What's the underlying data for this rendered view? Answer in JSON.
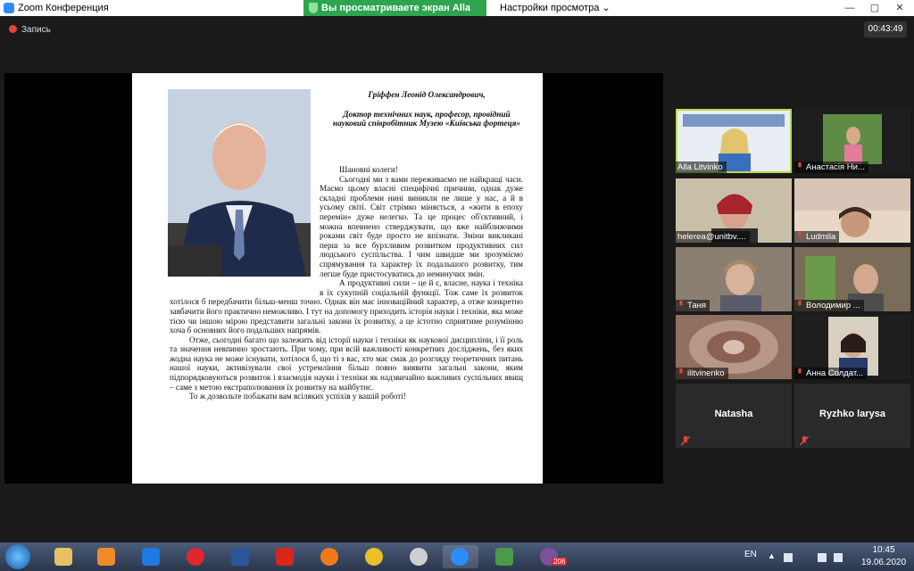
{
  "window": {
    "title": "Zoom Конференция",
    "minimize": "—",
    "maximize": "▢",
    "close": "✕"
  },
  "share_banner": {
    "text": "Вы просматриваете экран Alla Litvinko",
    "view_settings": "Настройки просмотра",
    "color": "#2da44e"
  },
  "toolbar": {
    "record_label": "Запись",
    "timer": "00:43:49"
  },
  "document": {
    "header": [
      "Гріффен Леонід Олександрович,",
      "Доктор технічних наук, професор, провідний науковий співробітник Музею «Київська фортеця»"
    ],
    "paragraphs": [
      "Шановні колеги!",
      "Сьогодні ми з вами переживаємо не найкращі часи. Маємо цьому власні специфічні причини, однак дуже складні проблеми нині виникли не лише у нас, а й в усьому світі. Світ стрімко міняється, а «жити в епоху перемін» дуже нелегко. Та це процес об'єктивний, і можна впевнено стверджувати, що вже найближчими роками світ буде просто не впізнати. Зміни викликані перш за все бурхливим розвитком продуктивних сил людського суспільства. І чим швидше ми зрозуміємо спрямування та характер їх подальшого розвитку, тим легше буде пристосуватись до неминучих змін.",
      "А продуктивні сили – це й є, власне, наука і техніка в їх сукупній соціальній функції. Тож саме їх розвиток хотілося б передбачити більш-менш точно. Однак він має інноваційний характер, а отже конкретно завбачити його практично неможливо. І тут на допомогу приходить історія науки і техніки, яка може тією чи іншою мірою представити загальні закони їх розвитку, а це істотно сприятиме розумінню хоча б основних його подальших напрямів.",
      "Отже, сьогодні багато що залежить від історії науки і техніки як наукової дисципліни, і її роль та значення невпинно зростають. При чому, при всій важливості конкретних досліджень, без яких жодна наука не може існувати, хотілося б, що ті з вас, хто має смак до розгляду теоретичних питань нашої науки, активізували свої устремління більш повно виявити загальні закони, яким підпорядковуються розвиток і взаємодія науки і техніки як надзвичайно важливих суспільних явищ – саме з метою екстраполювання їх розвитку на майбутнє.",
      "То ж дозвольте побажати вам всіляких успіхів у вашій роботі!"
    ]
  },
  "participants": [
    {
      "name": "Alla Litvinko",
      "muted": false,
      "active": true
    },
    {
      "name": "Анастасія Ни...",
      "muted": true
    },
    {
      "name": "helerea@unitbv....",
      "muted": false
    },
    {
      "name": "Ludmila",
      "muted": true
    },
    {
      "name": "Таня",
      "muted": true
    },
    {
      "name": "Володимир ...",
      "muted": true
    },
    {
      "name": "ilitvinenko",
      "muted": true
    },
    {
      "name": "Анна Солдат...",
      "muted": true
    },
    {
      "name": "Natasha",
      "muted": true,
      "no_video": true
    },
    {
      "name": "Ryzhko larysa",
      "muted": true,
      "no_video": true
    }
  ],
  "taskbar": {
    "language": "EN",
    "time": "10:45",
    "date": "19.06.2020",
    "viber_badge": "206",
    "apps": [
      "file-explorer-icon",
      "media-player-icon",
      "teamviewer-icon",
      "opera-icon",
      "word-icon",
      "acrobat-icon",
      "firefox-icon",
      "chrome-icon",
      "settings-icon",
      "zoom-icon",
      "vpn-icon",
      "viber-icon"
    ]
  }
}
